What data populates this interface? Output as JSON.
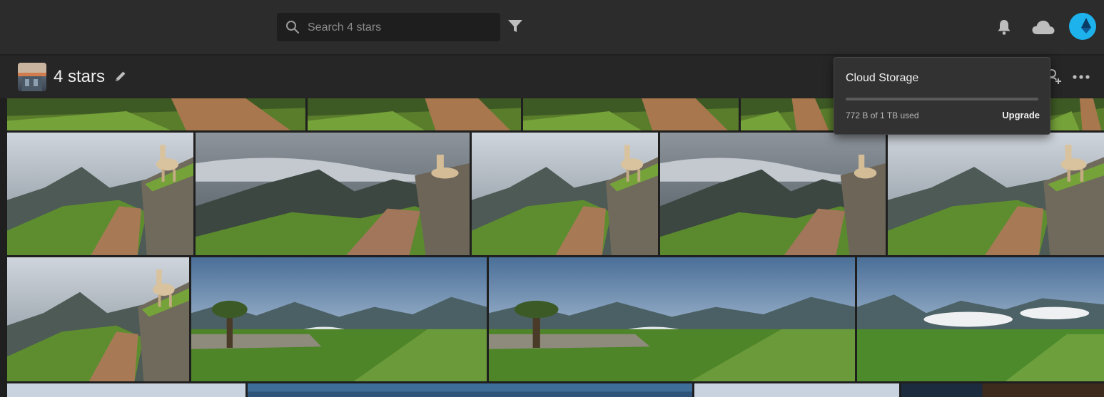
{
  "search": {
    "placeholder": "Search 4 stars",
    "value": ""
  },
  "icons": {
    "search": "search-icon",
    "filter": "filter-icon",
    "notifications": "bell-icon",
    "cloud": "cloud-icon",
    "edit": "pencil-icon",
    "share": "person-add-icon",
    "more": "more-icon"
  },
  "album": {
    "title": "4 stars"
  },
  "cloud_storage": {
    "title": "Cloud Storage",
    "used_text": "772 B of 1 TB used",
    "upgrade_label": "Upgrade",
    "used_fraction": 0.0
  },
  "colors": {
    "accent": "#1eb2ec",
    "topbar": "#2c2c2c",
    "background": "#1f1f1f"
  },
  "photos": [
    {
      "scene": "machu-picchu-llama-terraces"
    },
    {
      "scene": "machu-picchu-llama-terraces"
    },
    {
      "scene": "machu-picchu-llama-terraces"
    },
    {
      "scene": "machu-picchu-llama-terraces"
    },
    {
      "scene": "machu-picchu-llama-terraces"
    },
    {
      "scene": "machu-picchu-llama-closeup"
    },
    {
      "scene": "machu-picchu-llama-cloudy"
    },
    {
      "scene": "machu-picchu-llama-misty"
    },
    {
      "scene": "machu-picchu-llama-mountain"
    },
    {
      "scene": "machu-picchu-llama-mountain"
    },
    {
      "scene": "machu-picchu-llama-mountain"
    },
    {
      "scene": "machu-picchu-panorama-tree"
    },
    {
      "scene": "machu-picchu-panorama-tree"
    },
    {
      "scene": "machu-picchu-panorama-clouds"
    },
    {
      "scene": "sky-landscape"
    },
    {
      "scene": "sky-landscape"
    },
    {
      "scene": "sky-landscape"
    },
    {
      "scene": "sky-landscape"
    }
  ]
}
